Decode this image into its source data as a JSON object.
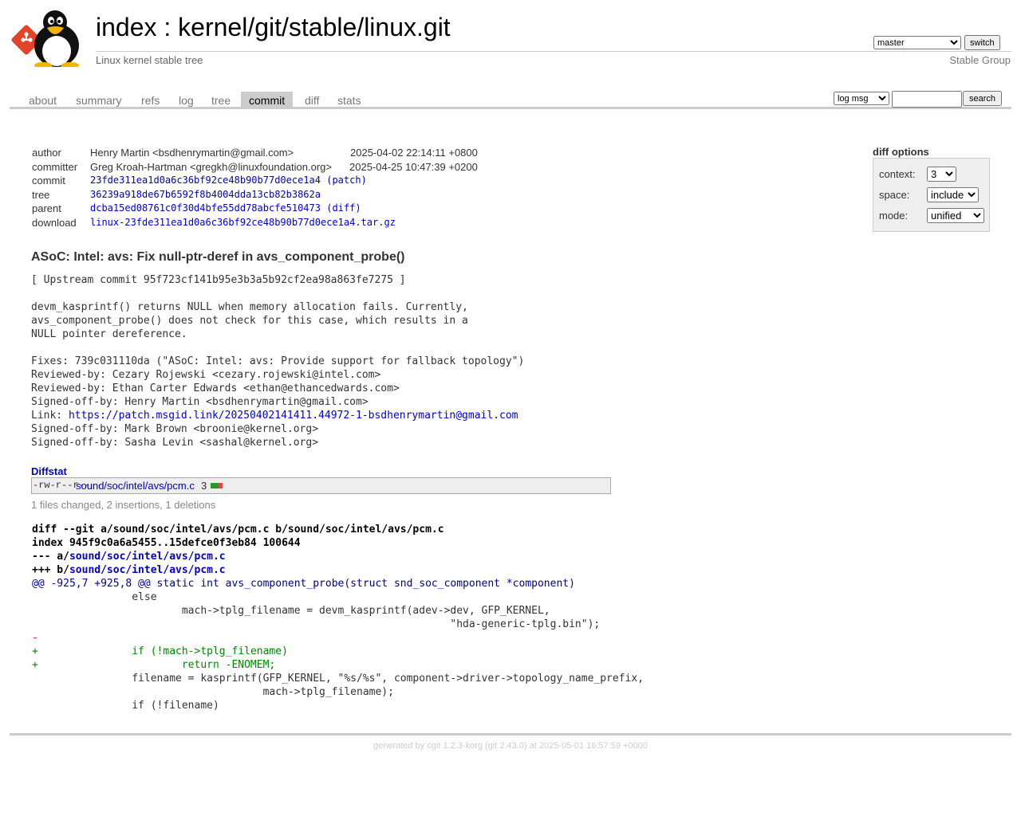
{
  "header": {
    "title_index": "index",
    "title_sep": " : ",
    "title_repo": "kernel/git/stable/linux.git",
    "subtitle": "Linux kernel stable tree",
    "owner": "Stable Group",
    "branch": "master",
    "switch_label": "switch"
  },
  "tabs": [
    "about",
    "summary",
    "refs",
    "log",
    "tree",
    "commit",
    "diff",
    "stats"
  ],
  "active_tab": "commit",
  "search": {
    "grep_option": "log msg",
    "button_label": "search",
    "value": ""
  },
  "info": {
    "author_label": "author",
    "author": "Henry Martin <bsdhenrymartin@gmail.com>",
    "author_date": "2025-04-02 22:14:11 +0800",
    "committer_label": "committer",
    "committer": "Greg Kroah-Hartman <gregkh@linuxfoundation.org>",
    "committer_date": "2025-04-25 10:47:39 +0200",
    "commit_label": "commit",
    "commit": "23fde311ea1d0a6c36bf92ce48b90b77d0ece1a4",
    "commit_patch": "(patch)",
    "tree_label": "tree",
    "tree": "36239a918de67b6592f8b4004dda13cb82b3862a",
    "parent_label": "parent",
    "parent": "dcba15ed08761c0f30d4bfe55dd78abcfe510473",
    "parent_diff": "(diff)",
    "download_label": "download",
    "download": "linux-23fde311ea1d0a6c36bf92ce48b90b77d0ece1a4.tar.gz"
  },
  "diff_options": {
    "title": "diff options",
    "context_label": "context:",
    "context_value": "3",
    "space_label": "space:",
    "space_value": "include",
    "mode_label": "mode:",
    "mode_value": "unified"
  },
  "subject": "ASoC: Intel: avs: Fix null-ptr-deref in avs_component_probe()",
  "message_lines": [
    "[ Upstream commit 95f723cf141b95e3b3a5b92cf2ea98a863fe7275 ]",
    "",
    "devm_kasprintf() returns NULL when memory allocation fails. Currently,",
    "avs_component_probe() does not check for this case, which results in a",
    "NULL pointer dereference.",
    "",
    "Fixes: 739c031110da (\"ASoC: Intel: avs: Provide support for fallback topology\")",
    "Reviewed-by: Cezary Rojewski <cezary.rojewski@intel.com>",
    "Reviewed-by: Ethan Carter Edwards <ethan@ethancedwards.com>",
    "Signed-off-by: Henry Martin <bsdhenrymartin@gmail.com>",
    "Link: ",
    "Signed-off-by: Mark Brown <broonie@kernel.org>",
    "Signed-off-by: Sasha Levin <sashal@kernel.org>"
  ],
  "message_link": "https://patch.msgid.link/20250402141411.44972-1-bsdhenrymartin@gmail.com",
  "diffstat": {
    "title": "Diffstat",
    "mode": "-rw-r--r--",
    "file": "sound/soc/intel/avs/pcm.c",
    "count": "3",
    "insertions": 2,
    "deletions": 1,
    "summary": "1 files changed, 2 insertions, 1 deletions",
    "add_color": "#2b9a2b",
    "del_color": "#e04848"
  },
  "diff": {
    "git_line": "diff --git a/sound/soc/intel/avs/pcm.c b/sound/soc/intel/avs/pcm.c",
    "index_line": "index 945f9c0a6a5455..15defce0f3eb84 100644",
    "minus_prefix": "--- a/",
    "plus_prefix": "+++ b/",
    "file": "sound/soc/intel/avs/pcm.c",
    "hunk_range": "@@ -925,7 +925,8 @@",
    "hunk_func": " static int avs_component_probe(struct snd_soc_component *component)",
    "lines": [
      {
        "type": "ctx",
        "text": "\t\telse"
      },
      {
        "type": "ctx",
        "text": "\t\t\tmach->tplg_filename = devm_kasprintf(adev->dev, GFP_KERNEL,"
      },
      {
        "type": "ctx",
        "text": "\t\t\t\t\t\t\t\t   \"hda-generic-tplg.bin\");"
      },
      {
        "type": "del",
        "text": "-"
      },
      {
        "type": "add",
        "text": "+\t\tif (!mach->tplg_filename)"
      },
      {
        "type": "add",
        "text": "+\t\t\treturn -ENOMEM;"
      },
      {
        "type": "ctx",
        "text": "\t\tfilename = kasprintf(GFP_KERNEL, \"%s/%s\", component->driver->topology_name_prefix,"
      },
      {
        "type": "ctx",
        "text": "\t\t\t\t     mach->tplg_filename);"
      },
      {
        "type": "ctx",
        "text": "\t\tif (!filename)"
      }
    ]
  },
  "footer": {
    "generated_by": "generated by ",
    "cgit": "cgit 1.2.3-korg",
    "git": " (git 2.43.0)",
    "at": " at 2025-05-01 16:57:59 +0000"
  }
}
